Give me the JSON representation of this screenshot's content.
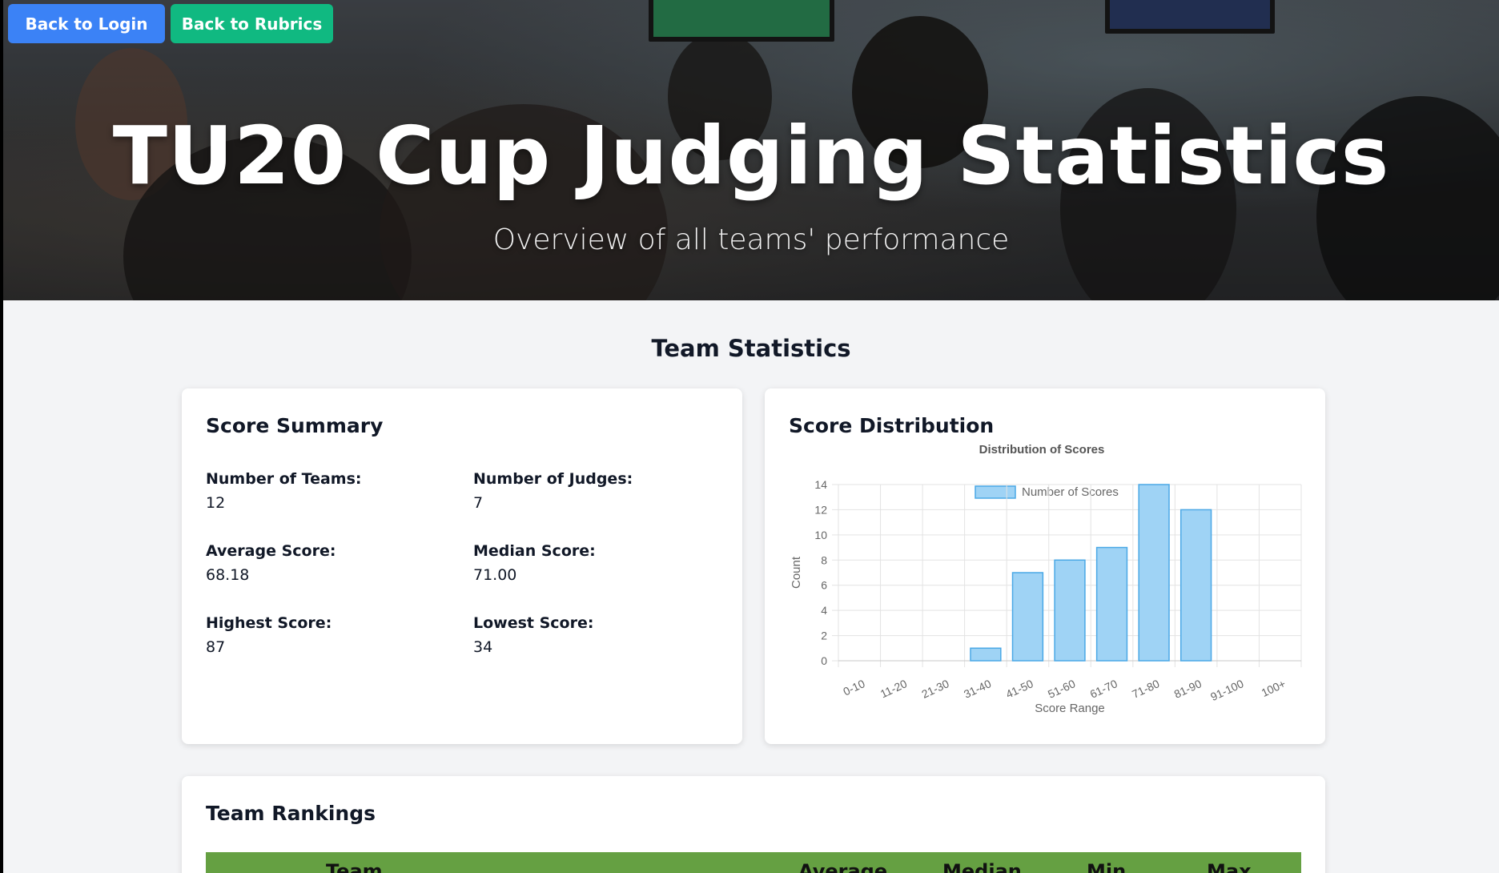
{
  "nav": {
    "back_login": "Back to Login",
    "back_rubrics": "Back to Rubrics"
  },
  "hero": {
    "title": "TU20 Cup Judging Statistics",
    "subtitle": "Overview of all teams' performance"
  },
  "section_title": "Team Statistics",
  "summary": {
    "title": "Score Summary",
    "stats": [
      {
        "label": "Number of Teams:",
        "value": "12"
      },
      {
        "label": "Number of Judges:",
        "value": "7"
      },
      {
        "label": "Average Score:",
        "value": "68.18"
      },
      {
        "label": "Median Score:",
        "value": "71.00"
      },
      {
        "label": "Highest Score:",
        "value": "87"
      },
      {
        "label": "Lowest Score:",
        "value": "34"
      }
    ]
  },
  "distribution": {
    "title": "Score Distribution"
  },
  "chart_data": {
    "type": "bar",
    "title": "Distribution of Scores",
    "categories": [
      "0-10",
      "11-20",
      "21-30",
      "31-40",
      "41-50",
      "51-60",
      "61-70",
      "71-80",
      "81-90",
      "91-100",
      "100+"
    ],
    "series": [
      {
        "name": "Number of Scores",
        "values": [
          0,
          0,
          0,
          1,
          7,
          8,
          9,
          14,
          12,
          0,
          0
        ]
      }
    ],
    "xlabel": "Score Range",
    "ylabel": "Count",
    "ylim": [
      0,
      14
    ],
    "yticks": [
      0,
      2,
      4,
      6,
      8,
      10,
      12,
      14
    ],
    "grid": true,
    "legend": "top",
    "bar_fill": "#9fd3f5",
    "bar_stroke": "#4aa8e6"
  },
  "rankings": {
    "title": "Team Rankings",
    "columns": [
      "Team",
      "Average",
      "Median",
      "Min",
      "Max"
    ]
  },
  "colors": {
    "login_button": "#3b82f6",
    "rubrics_button": "#10b981",
    "rank_header": "#65a042"
  }
}
